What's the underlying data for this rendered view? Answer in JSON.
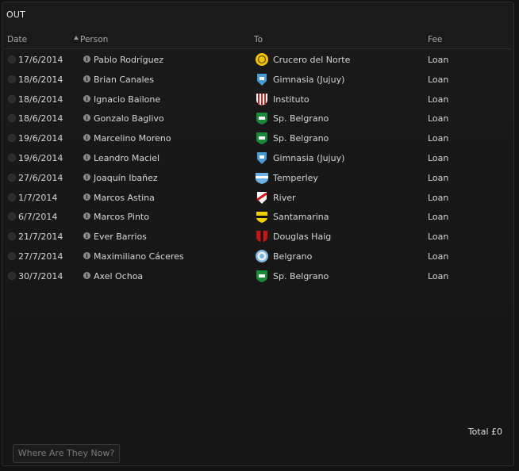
{
  "panel": {
    "title": "OUT"
  },
  "columns": {
    "date": "Date",
    "person": "Person",
    "to": "To",
    "fee": "Fee"
  },
  "rows": [
    {
      "date": "17/6/2014",
      "person": "Pablo Rodríguez",
      "to": "Crucero del Norte",
      "fee": "Loan",
      "badge": "crucero-del-norte-badge-icon"
    },
    {
      "date": "18/6/2014",
      "person": "Brian Canales",
      "to": "Gimnasia (Jujuy)",
      "fee": "Loan",
      "badge": "gimnasia-jujuy-badge-icon"
    },
    {
      "date": "18/6/2014",
      "person": "Ignacio Bailone",
      "to": "Instituto",
      "fee": "Loan",
      "badge": "instituto-badge-icon"
    },
    {
      "date": "18/6/2014",
      "person": "Gonzalo Baglivo",
      "to": "Sp. Belgrano",
      "fee": "Loan",
      "badge": "sp-belgrano-badge-icon"
    },
    {
      "date": "19/6/2014",
      "person": "Marcelino Moreno",
      "to": "Sp. Belgrano",
      "fee": "Loan",
      "badge": "sp-belgrano-badge-icon"
    },
    {
      "date": "19/6/2014",
      "person": "Leandro Maciel",
      "to": "Gimnasia (Jujuy)",
      "fee": "Loan",
      "badge": "gimnasia-jujuy-badge-icon"
    },
    {
      "date": "27/6/2014",
      "person": "Joaquín Ibañez",
      "to": "Temperley",
      "fee": "Loan",
      "badge": "temperley-badge-icon"
    },
    {
      "date": "1/7/2014",
      "person": "Marcos Astina",
      "to": "River",
      "fee": "Loan",
      "badge": "river-badge-icon"
    },
    {
      "date": "6/7/2014",
      "person": "Marcos Pinto",
      "to": "Santamarina",
      "fee": "Loan",
      "badge": "santamarina-badge-icon"
    },
    {
      "date": "21/7/2014",
      "person": "Ever Barrios",
      "to": "Douglas Haig",
      "fee": "Loan",
      "badge": "douglas-haig-badge-icon"
    },
    {
      "date": "27/7/2014",
      "person": "Maximiliano Cáceres",
      "to": "Belgrano",
      "fee": "Loan",
      "badge": "belgrano-badge-icon"
    },
    {
      "date": "30/7/2014",
      "person": "Axel Ochoa",
      "to": "Sp. Belgrano",
      "fee": "Loan",
      "badge": "sp-belgrano-badge-icon"
    }
  ],
  "footer": {
    "total": "Total £0",
    "button_label": "Where Are They Now?"
  },
  "colors": {
    "crucero": "#f2c200",
    "gimnasia": "#4a9ad4",
    "instituto": "#d02020",
    "belgrano_green": "#1a8a3a",
    "temperley": "#6ab0e0",
    "river": "#d01818",
    "santamarina": "#f0d000",
    "douglas": "#c01818",
    "belgrano_sky": "#7fb4dc"
  }
}
